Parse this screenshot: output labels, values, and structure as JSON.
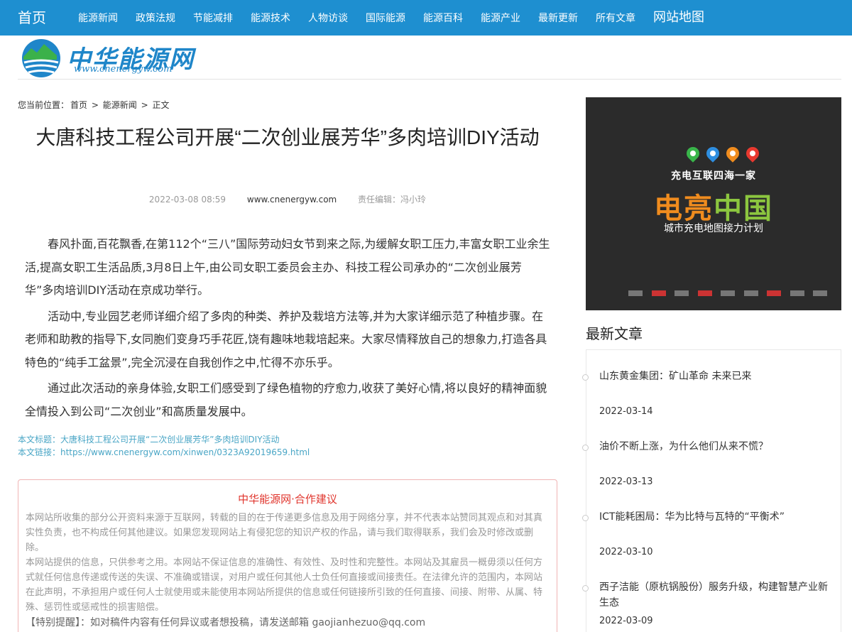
{
  "nav": {
    "home": "首页",
    "items": [
      "能源新闻",
      "政策法规",
      "节能减排",
      "能源技术",
      "人物访谈",
      "国际能源",
      "能源百科",
      "能源产业",
      "最新更新",
      "所有文章"
    ],
    "sitemap": "网站地图"
  },
  "logo": {
    "name": "中华能源网",
    "url": "www.cnenergyw.com"
  },
  "breadcrumb": {
    "prefix": "您当前位置：",
    "home": "首页",
    "sep1": ">",
    "section": "能源新闻",
    "sep2": ">",
    "current": "正文"
  },
  "article": {
    "title": "大唐科技工程公司开展“二次创业展芳华”多肉培训DIY活动",
    "date": "2022-03-08 08:59",
    "source": "www.cnenergyw.com",
    "editor": "责任编辑：冯小玲",
    "paragraphs": [
      "春风扑面,百花飘香,在第112个“三八”国际劳动妇女节到来之际,为缓解女职工压力,丰富女职工业余生活,提高女职工生活品质,3月8日上午,由公司女职工委员会主办、科技工程公司承办的“二次创业展芳华”多肉培训DIY活动在京成功举行。",
      "活动中,专业园艺老师详细介绍了多肉的种类、养护及栽培方法等,并为大家详细示范了种植步骤。在老师和助教的指导下,女同胞们变身巧手花匠,饶有趣味地栽培起来。大家尽情释放自己的想象力,打造各具特色的“纯手工盆景”,完全沉浸在自我创作之中,忙得不亦乐乎。",
      "通过此次活动的亲身体验,女职工们感受到了绿色植物的疗愈力,收获了美好心情,将以良好的精神面貌全情投入到公司“二次创业”和高质量发展中。"
    ],
    "info_title": "本文标题：大唐科技工程公司开展“二次创业展芳华”多肉培训DIY活动",
    "info_link": "本文链接：https://www.cnenergyw.com/xinwen/0323A92019659.html"
  },
  "notice": {
    "title": "中华能源网·合作建议",
    "para1": "本网站所收集的部分公开资料来源于互联网，转载的目的在于传递更多信息及用于网络分享，并不代表本站赞同其观点和对其真实性负责，也不构成任何其他建议。如果您发现网站上有侵犯您的知识产权的作品，请与我们取得联系，我们会及时修改或删除。",
    "para2": "本网站提供的信息，只供参考之用。本网站不保证信息的准确性、有效性、及时性和完整性。本网站及其雇员一概毋须以任何方式就任何信息传递或传送的失误、不准确或错误，对用户或任何其他人士负任何直接或间接责任。在法律允许的范围内，本网站在此声明，不承担用户或任何人士就使用或未能使用本网站所提供的信息或任何链接所引致的任何直接、间接、附带、从属、特殊、惩罚性或惩戒性的损害赔偿。",
    "contact": "【特别提醒】：如对稿件内容有任何异议或者想投稿，请发送邮箱 gaojianhezuo@qq.com"
  },
  "ad": {
    "headline": "充电互联四海一家",
    "main_part1": "电亮",
    "main_part2": "中国",
    "sub": "城市充电地图接力计划",
    "colors": {
      "orange": "#f08c1e",
      "blue": "#2e8ee0",
      "green": "#8cc63f",
      "pin_green": "#39b54a",
      "pin_red": "#e8392f"
    }
  },
  "latest": {
    "title": "最新文章",
    "items": [
      {
        "title": "山东黄金集团：矿山革命 未来已来",
        "date": "2022-03-14"
      },
      {
        "title": "油价不断上涨，为什么他们从来不慌？",
        "date": "2022-03-13"
      },
      {
        "title": "ICT能耗困局：华为比特与瓦特的“平衡术”",
        "date": "2022-03-10"
      },
      {
        "title": "西子洁能（原杭锅股份）服务升级，构建智慧产业新生态",
        "date": "2022-03-09"
      }
    ]
  }
}
